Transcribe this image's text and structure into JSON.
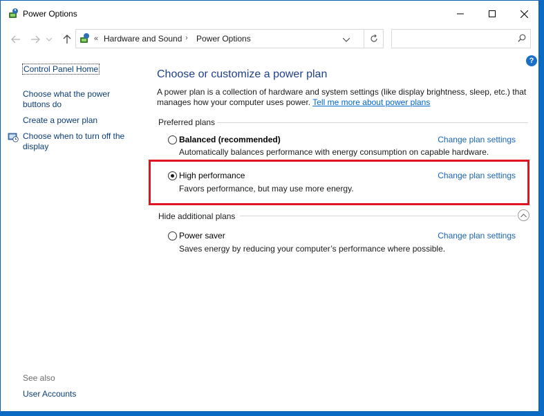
{
  "window": {
    "title": "Power Options"
  },
  "address": {
    "overflow_chevron": "«",
    "crumbs": [
      "Hardware and Sound",
      "Power Options"
    ],
    "separator": "›",
    "search_placeholder": ""
  },
  "left_nav": {
    "home": "Control Panel Home",
    "links": [
      "Choose what the power buttons do",
      "Create a power plan",
      "Choose when to turn off the display"
    ],
    "see_also_label": "See also",
    "see_also_links": [
      "User Accounts"
    ]
  },
  "main": {
    "title": "Choose or customize a power plan",
    "description": "A power plan is a collection of hardware and system settings (like display brightness, sleep, etc.) that manages how your computer uses power.",
    "more_link": "Tell me more about power plans",
    "preferred_label": "Preferred plans",
    "additional_label": "Hide additional plans",
    "change_label": "Change plan settings",
    "plans": [
      {
        "name": "Balanced (recommended)",
        "desc": "Automatically balances performance with energy consumption on capable hardware.",
        "selected": false
      },
      {
        "name": "High performance",
        "desc": "Favors performance, but may use more energy.",
        "selected": true
      },
      {
        "name": "Power saver",
        "desc": "Saves energy by reducing your computer’s performance where possible.",
        "selected": false
      }
    ]
  },
  "colors": {
    "highlight": "#e0141e",
    "link": "#1a64b5",
    "title": "#1e3f8a",
    "desktop": "#0b6bc4"
  }
}
